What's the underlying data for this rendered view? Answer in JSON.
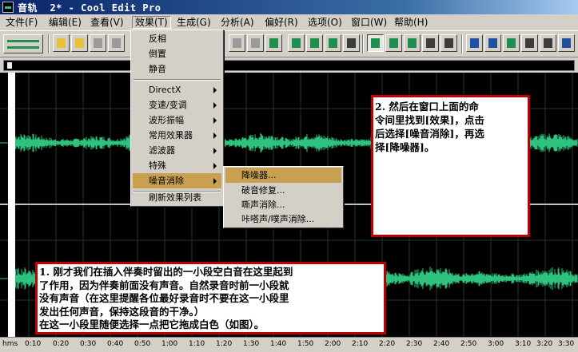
{
  "window": {
    "title": "音轨  2* - Cool Edit Pro"
  },
  "menubar": [
    {
      "label": "文件(F)"
    },
    {
      "label": "编辑(E)"
    },
    {
      "label": "查看(V)"
    },
    {
      "label": "效果(T)"
    },
    {
      "label": "生成(G)"
    },
    {
      "label": "分析(A)"
    },
    {
      "label": "偏好(R)"
    },
    {
      "label": "选项(O)"
    },
    {
      "label": "窗口(W)"
    },
    {
      "label": "帮助(H)"
    }
  ],
  "effects_menu": {
    "items": [
      "反相",
      "倒置",
      "静音",
      "DirectX",
      "变速/变调",
      "波形振幅",
      "常用效果器",
      "滤波器",
      "特殊",
      "噪音消除",
      "刷新效果列表"
    ]
  },
  "noise_submenu": {
    "items": [
      "降噪器...",
      "破音修复...",
      "嘶声消除...",
      "咔嗒声/噗声消除..."
    ]
  },
  "ruler": {
    "labels": [
      "hms",
      "0:10",
      "0:20",
      "0:30",
      "0:40",
      "0:50",
      "1:00",
      "1:10",
      "1:20",
      "1:30",
      "1:40",
      "1:50",
      "2:00",
      "2:10",
      "2:20",
      "2:30",
      "2:40",
      "2:50",
      "3:00",
      "3:10",
      "3:20",
      "3:30"
    ]
  },
  "annotations": {
    "right": [
      "2. 然后在窗口上面的命",
      "令间里找到[效果]，点击",
      "后选择[噪音消除]，再选",
      "择[降噪器]。"
    ],
    "bottom": [
      "1. 刚才我们在插入伴奏时留出的一小段空白音在这里起到",
      "了作用，因为伴奏前面没有声音。自然录音时前一小段就",
      "没有声音（在这里提醒各位最好录音时不要在这一小段里",
      "发出任何声音，保持这段音的干净。）",
      "在这一小段里随便选择一点把它拖成白色（如图）。"
    ]
  },
  "colors": {
    "waveform": "#2ec27e",
    "waveform_background": "#000000",
    "highlight": "#c8a050",
    "annotation_border": "#c00000"
  }
}
